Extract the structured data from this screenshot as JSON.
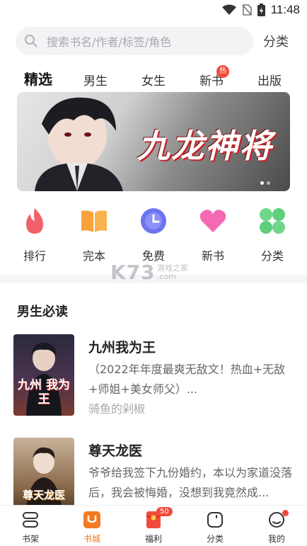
{
  "status_bar": {
    "time": "11:48"
  },
  "search": {
    "placeholder": "搜索书名/作者/标签/角色",
    "category_label": "分类"
  },
  "tabs": [
    {
      "label": "精选",
      "active": true
    },
    {
      "label": "男生"
    },
    {
      "label": "女生"
    },
    {
      "label": "新书",
      "badge": "热"
    },
    {
      "label": "出版"
    }
  ],
  "banner": {
    "title": "九龙神将",
    "pages": 2,
    "current_page": 1
  },
  "shortcuts": [
    {
      "label": "排行",
      "icon": "flame-icon"
    },
    {
      "label": "完本",
      "icon": "open-book-icon"
    },
    {
      "label": "免费",
      "icon": "clock-icon"
    },
    {
      "label": "新书",
      "icon": "heart-icon"
    },
    {
      "label": "分类",
      "icon": "grid-icon"
    }
  ],
  "watermark": {
    "text": "K73",
    "sub1": "游戏之家",
    "sub2": ".com"
  },
  "section": {
    "title": "男生必读"
  },
  "books": [
    {
      "title": "九州我为王",
      "cover_text": "九州 我为王",
      "desc": "（2022年年度最爽无敌文！热血+无敌+师姐+美女师父）...",
      "author": "骑鱼的剁椒"
    },
    {
      "title": "尊天龙医",
      "cover_text": "尊天龙医",
      "desc": "爷爷给我签下九份婚约，本以为家道没落后，我会被悔婚，没想到我竟然成...",
      "author": ""
    }
  ],
  "bottom_nav": [
    {
      "label": "书架",
      "icon": "bookshelf-icon"
    },
    {
      "label": "书城",
      "icon": "bookstore-icon",
      "active": true
    },
    {
      "label": "福利",
      "icon": "red-envelope-icon",
      "badge": "50"
    },
    {
      "label": "分类",
      "icon": "category-icon"
    },
    {
      "label": "我的",
      "icon": "profile-icon",
      "dot": true
    }
  ],
  "colors": {
    "accent": "#f47a20",
    "badge": "#f04b3a"
  }
}
